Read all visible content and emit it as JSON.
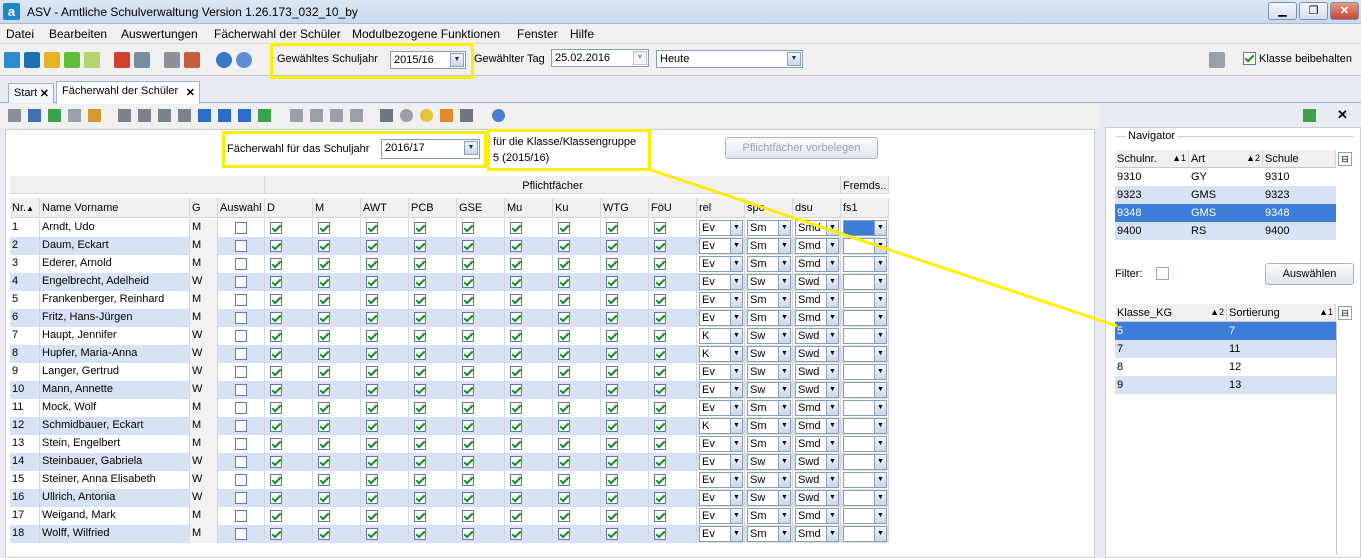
{
  "window": {
    "title": "ASV - Amtliche Schulverwaltung Version 1.26.173_032_10_by",
    "app_icon": "a"
  },
  "menu": [
    "Datei",
    "Bearbeiten",
    "Auswertungen",
    "Fächerwahl der Schüler",
    "Modulbezogene Funktionen",
    "Fenster",
    "Hilfe"
  ],
  "toolbar": {
    "schuljahr_label": "Gewähltes Schuljahr",
    "schuljahr_value": "2015/16",
    "tag_label": "Gewählter Tag",
    "tag_value": "25.02.2016",
    "heute_value": "Heute",
    "klasse_beibehalten_label": "Klasse beibehalten",
    "klasse_beibehalten_checked": true
  },
  "tabs": [
    {
      "label": "Start",
      "active": false
    },
    {
      "label": "Fächerwahl der Schüler",
      "active": true
    }
  ],
  "form": {
    "schuljahr_label": "Fächerwahl für das Schuljahr",
    "schuljahr_value": "2016/17",
    "klasse_label": "für die Klasse/Klassengruppe",
    "klasse_value": "5 (2015/16)",
    "vorbelegen_button": "Pflichtfächer vorbelegen"
  },
  "grid": {
    "group_headers": {
      "pflicht": "Pflichtfächer",
      "fremd": "Fremds.."
    },
    "columns": [
      "Nr.",
      "Name Vorname",
      "G",
      "Auswahl",
      "D",
      "M",
      "AWT",
      "PCB",
      "GSE",
      "Mu",
      "Ku",
      "WTG",
      "FöU",
      "rel",
      "spo",
      "dsu",
      "fs1"
    ],
    "rows": [
      {
        "nr": "1",
        "name": "Arndt, Udo",
        "g": "M",
        "rel": "Ev",
        "spo": "Sm",
        "dsu": "Smd"
      },
      {
        "nr": "2",
        "name": "Daum, Eckart",
        "g": "M",
        "rel": "Ev",
        "spo": "Sm",
        "dsu": "Smd"
      },
      {
        "nr": "3",
        "name": "Ederer, Arnold",
        "g": "M",
        "rel": "Ev",
        "spo": "Sm",
        "dsu": "Smd"
      },
      {
        "nr": "4",
        "name": "Engelbrecht, Adelheid",
        "g": "W",
        "rel": "Ev",
        "spo": "Sw",
        "dsu": "Swd"
      },
      {
        "nr": "5",
        "name": "Frankenberger, Reinhard",
        "g": "M",
        "rel": "Ev",
        "spo": "Sm",
        "dsu": "Smd"
      },
      {
        "nr": "6",
        "name": "Fritz, Hans-Jürgen",
        "g": "M",
        "rel": "Ev",
        "spo": "Sm",
        "dsu": "Smd"
      },
      {
        "nr": "7",
        "name": "Haupt, Jennifer",
        "g": "W",
        "rel": "K",
        "spo": "Sw",
        "dsu": "Swd"
      },
      {
        "nr": "8",
        "name": "Hupfer, Maria-Anna",
        "g": "W",
        "rel": "K",
        "spo": "Sw",
        "dsu": "Swd"
      },
      {
        "nr": "9",
        "name": "Langer, Gertrud",
        "g": "W",
        "rel": "Ev",
        "spo": "Sw",
        "dsu": "Swd"
      },
      {
        "nr": "10",
        "name": "Mann, Annette",
        "g": "W",
        "rel": "Ev",
        "spo": "Sw",
        "dsu": "Swd"
      },
      {
        "nr": "11",
        "name": "Mock, Wolf",
        "g": "M",
        "rel": "Ev",
        "spo": "Sm",
        "dsu": "Smd"
      },
      {
        "nr": "12",
        "name": "Schmidbauer, Eckart",
        "g": "M",
        "rel": "K",
        "spo": "Sm",
        "dsu": "Smd"
      },
      {
        "nr": "13",
        "name": "Stein, Engelbert",
        "g": "M",
        "rel": "Ev",
        "spo": "Sm",
        "dsu": "Smd"
      },
      {
        "nr": "14",
        "name": "Steinbauer, Gabriela",
        "g": "W",
        "rel": "Ev",
        "spo": "Sw",
        "dsu": "Swd"
      },
      {
        "nr": "15",
        "name": "Steiner, Anna Elisabeth",
        "g": "W",
        "rel": "Ev",
        "spo": "Sw",
        "dsu": "Swd"
      },
      {
        "nr": "16",
        "name": "Ullrich, Antonia",
        "g": "W",
        "rel": "Ev",
        "spo": "Sw",
        "dsu": "Swd"
      },
      {
        "nr": "17",
        "name": "Weigand, Mark",
        "g": "M",
        "rel": "Ev",
        "spo": "Sm",
        "dsu": "Smd"
      },
      {
        "nr": "18",
        "name": "Wolff, Wilfried",
        "g": "M",
        "rel": "Ev",
        "spo": "Sm",
        "dsu": "Smd"
      }
    ]
  },
  "navigator": {
    "title": "Navigator",
    "schul_columns": [
      "Schulnr.",
      "Art",
      "Schule"
    ],
    "schul_sort": [
      "▲1",
      "▲2"
    ],
    "schulen": [
      {
        "nr": "9310",
        "art": "GY",
        "schule": "9310"
      },
      {
        "nr": "9323",
        "art": "GMS",
        "schule": "9323"
      },
      {
        "nr": "9348",
        "art": "GMS",
        "schule": "9348",
        "selected": true
      },
      {
        "nr": "9400",
        "art": "RS",
        "schule": "9400"
      }
    ],
    "filter_label": "Filter:",
    "auswaehlen_button": "Auswählen",
    "klassen_columns": [
      "Klasse_KG",
      "Sortierung"
    ],
    "klassen_sort": [
      "▲2",
      "▲1"
    ],
    "klassen": [
      {
        "klasse": "5",
        "sort": "7",
        "selected": true
      },
      {
        "klasse": "7",
        "sort": "11"
      },
      {
        "klasse": "8",
        "sort": "12"
      },
      {
        "klasse": "9",
        "sort": "13"
      }
    ]
  },
  "colors": {
    "highlight": "#ffee00",
    "selection": "#3b7dd8",
    "row_alt": "#d7e3f5"
  }
}
